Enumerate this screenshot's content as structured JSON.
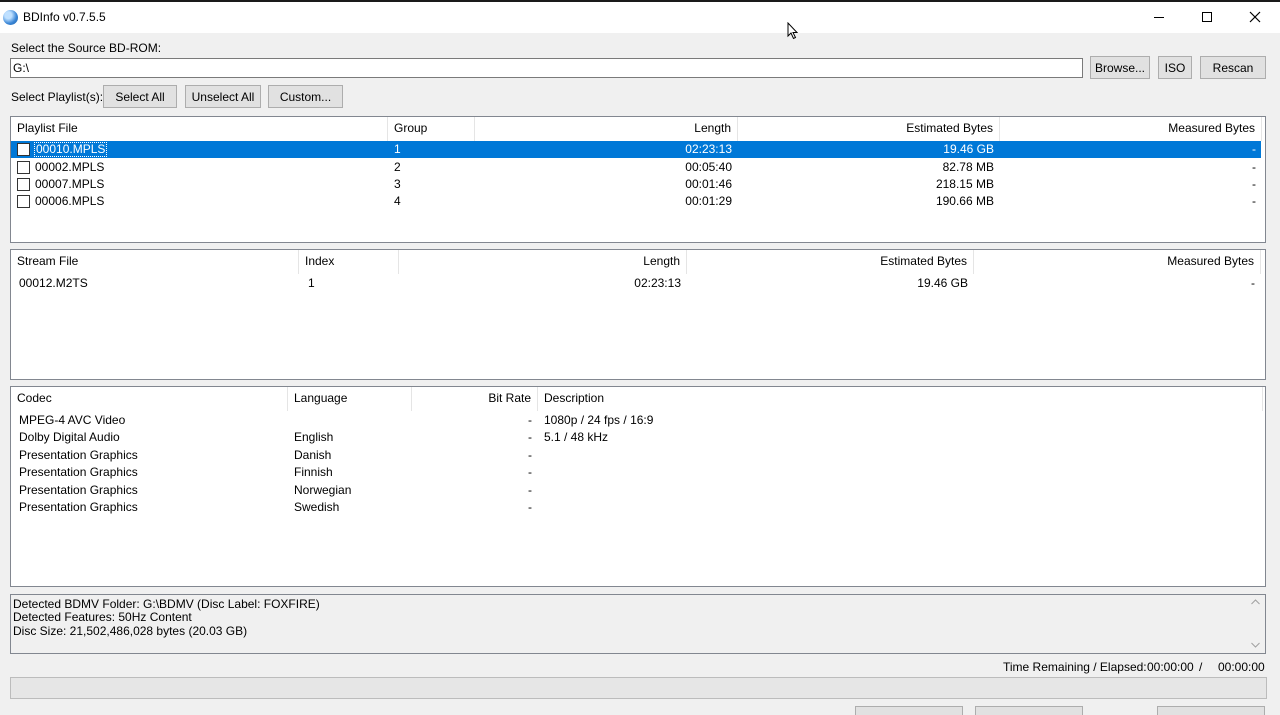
{
  "window": {
    "title": "BDInfo v0.7.5.5"
  },
  "source": {
    "label": "Select the Source BD-ROM:",
    "path": "G:\\",
    "browse_label": "Browse...",
    "iso_label": "ISO",
    "rescan_label": "Rescan"
  },
  "playlist_select": {
    "label": "Select Playlist(s):",
    "select_all": "Select All",
    "unselect_all": "Unselect All",
    "custom": "Custom..."
  },
  "playlists": {
    "columns": [
      "Playlist File",
      "Group",
      "Length",
      "Estimated Bytes",
      "Measured Bytes"
    ],
    "rows": [
      {
        "file": "00010.MPLS",
        "group": "1",
        "length": "02:23:13",
        "estimated": "19.46 GB",
        "measured": "-"
      },
      {
        "file": "00002.MPLS",
        "group": "2",
        "length": "00:05:40",
        "estimated": "82.78 MB",
        "measured": "-"
      },
      {
        "file": "00007.MPLS",
        "group": "3",
        "length": "00:01:46",
        "estimated": "218.15 MB",
        "measured": "-"
      },
      {
        "file": "00006.MPLS",
        "group": "4",
        "length": "00:01:29",
        "estimated": "190.66 MB",
        "measured": "-"
      }
    ]
  },
  "streams": {
    "columns": [
      "Stream File",
      "Index",
      "Length",
      "Estimated Bytes",
      "Measured Bytes"
    ],
    "rows": [
      {
        "file": "00012.M2TS",
        "index": "1",
        "length": "02:23:13",
        "estimated": "19.46 GB",
        "measured": "-"
      }
    ]
  },
  "codecs": {
    "columns": [
      "Codec",
      "Language",
      "Bit Rate",
      "Description"
    ],
    "rows": [
      {
        "codec": "MPEG-4 AVC Video",
        "language": "",
        "bitrate": "-",
        "description": "1080p / 24 fps / 16:9"
      },
      {
        "codec": "Dolby Digital Audio",
        "language": "English",
        "bitrate": "-",
        "description": "5.1 / 48 kHz"
      },
      {
        "codec": "Presentation Graphics",
        "language": "Danish",
        "bitrate": "-",
        "description": ""
      },
      {
        "codec": "Presentation Graphics",
        "language": "Finnish",
        "bitrate": "-",
        "description": ""
      },
      {
        "codec": "Presentation Graphics",
        "language": "Norwegian",
        "bitrate": "-",
        "description": ""
      },
      {
        "codec": "Presentation Graphics",
        "language": "Swedish",
        "bitrate": "-",
        "description": ""
      }
    ]
  },
  "info": {
    "lines": [
      "Detected BDMV Folder: G:\\BDMV (Disc Label: FOXFIRE)",
      "Detected Features: 50Hz Content",
      "Disc Size: 21,502,486,028 bytes (20.03 GB)"
    ]
  },
  "status": {
    "label": "Time Remaining / Elapsed:",
    "remaining": "00:00:00",
    "separator": "/",
    "elapsed": "00:00:00",
    "progress": 0
  }
}
